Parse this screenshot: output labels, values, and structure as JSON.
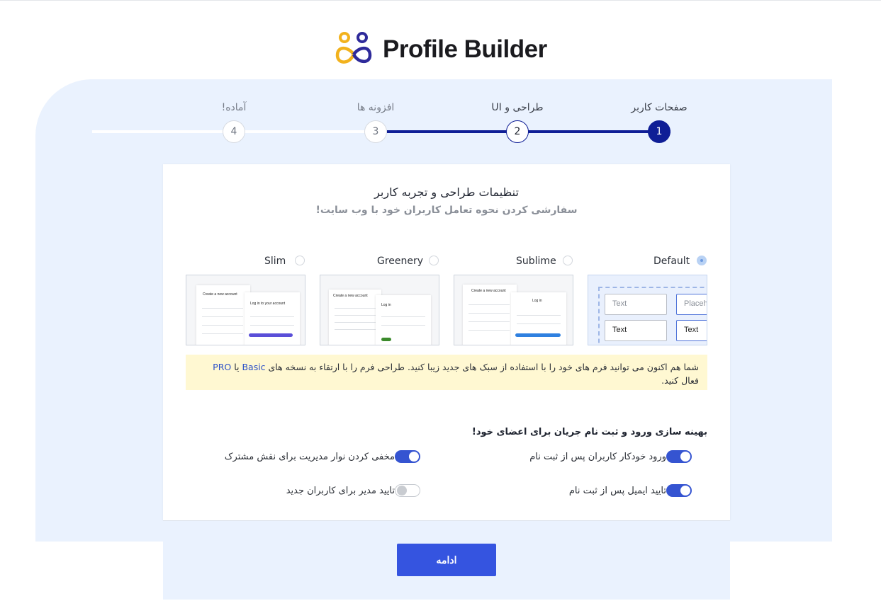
{
  "brand": {
    "name": "Profile Builder"
  },
  "steps": [
    {
      "number": "1",
      "label": "صفحات کاربر",
      "state": "done"
    },
    {
      "number": "2",
      "label": "طراحی و UI",
      "state": "active"
    },
    {
      "number": "3",
      "label": "افزونه ها",
      "state": "pending"
    },
    {
      "number": "4",
      "label": "آماده!",
      "state": "pending"
    }
  ],
  "card": {
    "title": "تنظیمات طراحی و تجربه کاربر",
    "subtitle": "سفارشی کردن نحوه تعامل کاربران خود با وب سایت!"
  },
  "templates": [
    {
      "label": "Default",
      "selected": true
    },
    {
      "label": "Sublime",
      "selected": false
    },
    {
      "label": "Greenery",
      "selected": false
    },
    {
      "label": "Slim",
      "selected": false
    }
  ],
  "template_previews": {
    "default": {
      "field1": "Text",
      "field2": "Placeholder",
      "field3": "Text",
      "field4": "Text"
    },
    "sublime": {
      "register_title": "Create a new account",
      "login_title": "Log in"
    },
    "greenery": {
      "register_title": "Create a new account",
      "login_title": "Log in"
    },
    "slim": {
      "register_title": "Create a new account",
      "login_title": "Log in to your account"
    }
  },
  "notice": {
    "text_before": "شما هم اکنون می توانید فرم های خود را با استفاده از سبک های جدید زیبا کنید. طراحی فرم را با ارتقاء به نسخه های ",
    "link_basic": "Basic",
    "text_or": " یا ",
    "link_pro": "PRO",
    "text_after": " فعال کنید."
  },
  "options": {
    "heading": "بهینه سازی ورود و ثبت نام جریان برای اعضای خود!",
    "items": [
      {
        "label": "ورود خودکار کاربران پس از ثبت نام",
        "enabled": true
      },
      {
        "label": "مخفی کردن نوار مدیریت برای نقش مشترک",
        "enabled": true
      },
      {
        "label": "تایید ایمیل پس از ثبت نام",
        "enabled": true
      },
      {
        "label": "تایید مدیر برای کاربران جدید",
        "enabled": false
      }
    ]
  },
  "footer": {
    "continue_label": "ادامه"
  },
  "colors": {
    "primary": "#3554e0",
    "step_active": "#0f1e96",
    "background_blob": "#eaf2fe",
    "notice_bg": "#fff8d2"
  }
}
